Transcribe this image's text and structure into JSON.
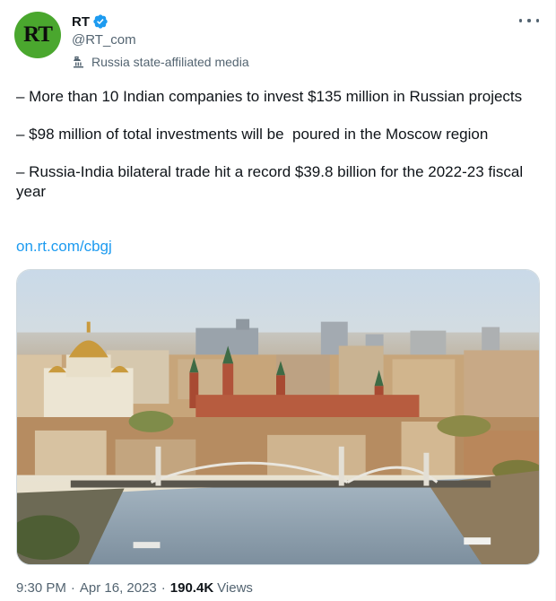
{
  "author": {
    "display_name": "RT",
    "handle": "@RT_com",
    "avatar_text": "RT",
    "affiliation_label": "Russia state-affiliated media",
    "verified": true
  },
  "tweet": {
    "paragraphs": [
      "– More than 10 Indian companies to invest $135 million in Russian projects",
      "– $98 million of total investments will be  poured in the Moscow region",
      "– Russia-India bilateral trade hit a record $39.8 billion for the 2022-23 fiscal year"
    ],
    "link_text": "on.rt.com/cbgj"
  },
  "meta": {
    "time": "9:30 PM",
    "separator": "·",
    "date": "Apr 16, 2023",
    "views_count": "190.4K",
    "views_label": "Views"
  },
  "colors": {
    "accent": "#1d9bf0",
    "avatar_bg": "#4aa72e",
    "secondary_text": "#536471"
  },
  "icons": {
    "verified": "verified-badge-icon",
    "affiliation": "state-media-flag-icon",
    "more": "more-options-icon"
  }
}
